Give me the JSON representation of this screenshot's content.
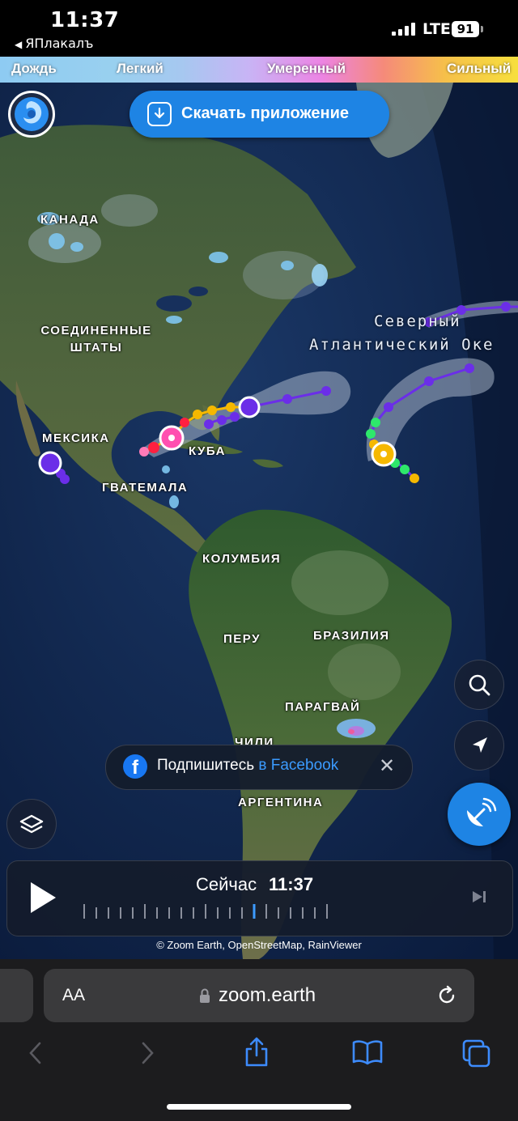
{
  "status_bar": {
    "time": "11:37",
    "back_app": "ЯПлакалъ",
    "network": "LTE",
    "battery": "91"
  },
  "precip_legend": {
    "labels": [
      "Дождь",
      "Легкий",
      "Умеренный",
      "Сильный"
    ]
  },
  "header": {
    "download_label": "Скачать приложение"
  },
  "map": {
    "country_labels": [
      "КАНАДА",
      "СОЕДИНЕННЫЕ ШТАТЫ",
      "МЕКСИКА",
      "ГВАТЕМАЛА",
      "КУБА",
      "КОЛУМБИЯ",
      "ПЕРУ",
      "БРАЗИЛИЯ",
      "ПАРАГВАЙ",
      "ЧИЛИ",
      "АРГЕНТИНА"
    ],
    "ocean_label_line1": "Северный",
    "ocean_label_line2": "Атлантический Оке",
    "ocean_label_partial": "А...тл"
  },
  "facebook_toast": {
    "prefix": "Подпишитесь ",
    "highlight": "в Facebook",
    "close": "✕"
  },
  "player": {
    "now_label": "Сейчас",
    "time": "11:37"
  },
  "attribution": "© Zoom Earth, OpenStreetMap, RainViewer",
  "browser": {
    "aa_label": "AA",
    "url": "zoom.earth"
  },
  "colors": {
    "accent": "#1e84e4",
    "storm_purple": "#6b2ee8",
    "storm_yellow": "#f5b800",
    "storm_pink": "#ff4fb0",
    "storm_red": "#ff2040",
    "storm_green": "#2ee86b"
  }
}
